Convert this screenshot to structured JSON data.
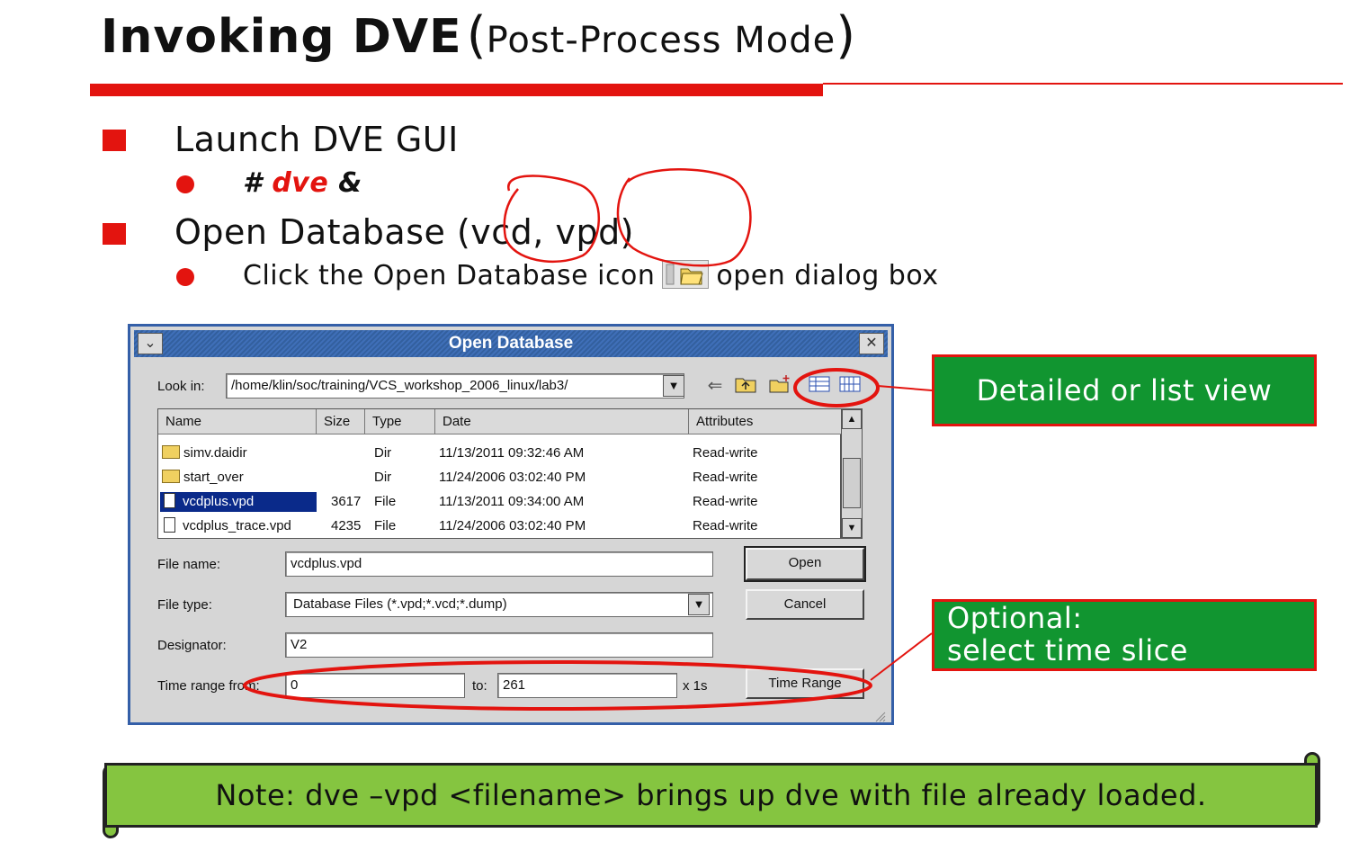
{
  "slide": {
    "title_main": "Invoking DVE",
    "title_paren_open": "(",
    "title_sub": "Post-Process Mode",
    "title_paren_close": ")",
    "bullet1": "Launch DVE GUI",
    "bullet1_sub_hash": "#",
    "bullet1_sub_cmd": "dve",
    "bullet1_sub_amp": "&",
    "bullet2": "Open Database (vcd, vpd)",
    "bullet2_sub_before": "Click the Open Database icon",
    "bullet2_sub_after": "open dialog box"
  },
  "dialog": {
    "title": "Open Database",
    "look_in_label": "Look in:",
    "look_in_value": "/home/klin/soc/training/VCS_workshop_2006_linux/lab3/",
    "columns": [
      "Name",
      "Size",
      "Type",
      "Date",
      "Attributes"
    ],
    "rows": [
      {
        "name": "simv.daidir",
        "size": "",
        "type": "Dir",
        "date": "11/13/2011 09:32:46 AM",
        "attributes": "Read-write",
        "kind": "folder"
      },
      {
        "name": "start_over",
        "size": "",
        "type": "Dir",
        "date": "11/24/2006 03:02:40 PM",
        "attributes": "Read-write",
        "kind": "folder"
      },
      {
        "name": "vcdplus.vpd",
        "size": "3617",
        "type": "File",
        "date": "11/13/2011 09:34:00 AM",
        "attributes": "Read-write",
        "kind": "file"
      },
      {
        "name": "vcdplus_trace.vpd",
        "size": "4235",
        "type": "File",
        "date": "11/24/2006 03:02:40 PM",
        "attributes": "Read-write",
        "kind": "file"
      }
    ],
    "file_name_label": "File name:",
    "file_name_value": "vcdplus.vpd",
    "file_type_label": "File type:",
    "file_type_value": "Database Files (*.vpd;*.vcd;*.dump)",
    "designator_label": "Designator:",
    "designator_value": "V2",
    "time_range_label": "Time range from:",
    "time_from_value": "0",
    "to_label": "to:",
    "time_to_value": "261",
    "time_unit": "x 1s",
    "open_button": "Open",
    "cancel_button": "Cancel",
    "time_range_button": "Time Range"
  },
  "callouts": {
    "view": "Detailed or list view",
    "time_slice_line1": "Optional:",
    "time_slice_line2": "select time slice"
  },
  "note": "Note: dve –vpd <filename> brings up dve with file already loaded.",
  "colors": {
    "accent_red": "#e3140f",
    "callout_green": "#119530",
    "note_green": "#85c540",
    "dialog_blue": "#345fa8",
    "selection_blue": "#0a2a8a"
  }
}
